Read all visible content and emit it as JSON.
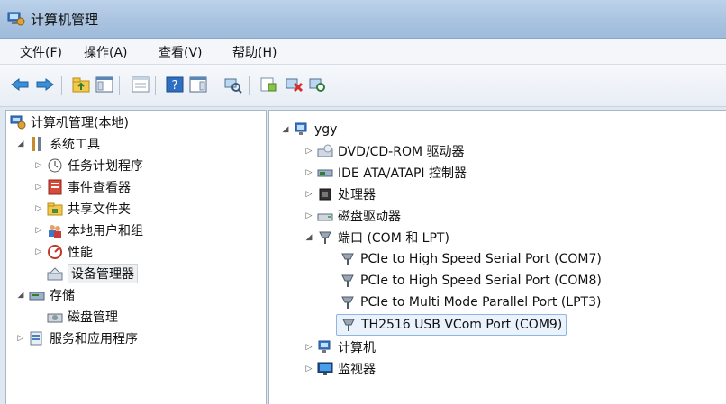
{
  "window": {
    "title": "计算机管理"
  },
  "menu": [
    {
      "label": "文件(F)"
    },
    {
      "label": "操作(A)"
    },
    {
      "label": "查看(V)"
    },
    {
      "label": "帮助(H)"
    }
  ],
  "toolbar": {
    "buttons": [
      "back-arrow-icon",
      "forward-arrow-icon",
      "up-folder-icon",
      "show-hide-console-tree-icon",
      "properties-icon",
      "help-icon",
      "show-action-pane-icon",
      "scan-hardware-icon",
      "update-driver-icon",
      "uninstall-device-icon",
      "disable-device-icon"
    ]
  },
  "left_tree": {
    "root": "计算机管理(本地)",
    "system_tools": "系统工具",
    "task_scheduler": "任务计划程序",
    "event_viewer": "事件查看器",
    "shared_folders": "共享文件夹",
    "local_users": "本地用户和组",
    "performance": "性能",
    "device_manager": "设备管理器",
    "storage": "存储",
    "disk_management": "磁盘管理",
    "services_apps": "服务和应用程序"
  },
  "right_tree": {
    "computer_name": "ygy",
    "dvd": "DVD/CD-ROM 驱动器",
    "ide": "IDE ATA/ATAPI 控制器",
    "processor": "处理器",
    "disk_drives": "磁盘驱动器",
    "ports": "端口 (COM 和 LPT)",
    "port1": "PCIe to High Speed Serial Port (COM7)",
    "port2": "PCIe to High Speed Serial Port (COM8)",
    "port3": "PCIe to Multi Mode Parallel Port (LPT3)",
    "port4": "TH2516 USB VCom Port (COM9)",
    "computer": "计算机",
    "monitors": "监视器"
  }
}
